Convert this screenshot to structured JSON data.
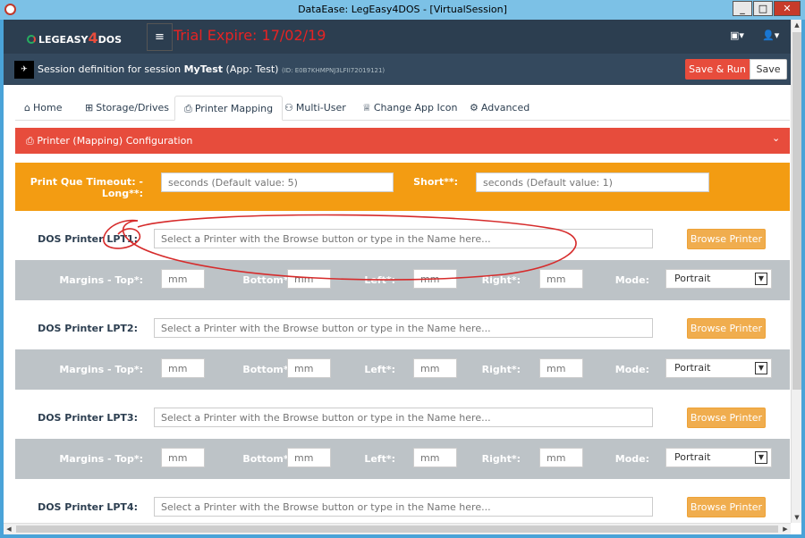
{
  "window": {
    "title": "DataEase: LegEasy4DOS - [VirtualSession]",
    "minimize": "_",
    "maximize": "□",
    "close": "✕"
  },
  "navbar": {
    "logo_prefix": "LEGEASY",
    "logo_four": "4",
    "logo_suffix": "DOS",
    "menu_icon": "≡",
    "trial_text": "Trial Expire: 17/02/19",
    "briefcase_icon": "▣▾",
    "user_icon": "👤▾"
  },
  "session": {
    "prefix": "Session definition for session",
    "name": "MyTest",
    "app": "(App: Test)",
    "id": "(ID: E0B7KHMPNJ3LFII72019121)",
    "save_run_label": "Save & Run",
    "save_label": "Save"
  },
  "tabs": [
    {
      "icon": "⌂",
      "label": "Home"
    },
    {
      "icon": "⊞",
      "label": "Storage/Drives"
    },
    {
      "icon": "⎙",
      "label": "Printer Mapping"
    },
    {
      "icon": "⚇",
      "label": "Multi-User"
    },
    {
      "icon": "♕",
      "label": "Change App Icon"
    },
    {
      "icon": "⚙",
      "label": "Advanced"
    }
  ],
  "active_tab": "Printer Mapping",
  "panel": {
    "icon": "⎙",
    "title": "Printer (Mapping) Configuration",
    "collapse_icon": "⌄"
  },
  "timeout": {
    "long_label_1": "Print Que Timeout: -",
    "long_label_2": "Long**:",
    "long_placeholder": "seconds (Default value: 5)",
    "short_label": "Short**:",
    "short_placeholder": "seconds (Default value: 1)"
  },
  "printers": [
    {
      "label": "DOS Printer LPT1:",
      "placeholder": "Select a Printer with the Browse button or type in the Name here...",
      "browse": "Browse Printer"
    },
    {
      "label": "DOS Printer LPT2:",
      "placeholder": "Select a Printer with the Browse button or type in the Name here...",
      "browse": "Browse Printer"
    },
    {
      "label": "DOS Printer LPT3:",
      "placeholder": "Select a Printer with the Browse button or type in the Name here...",
      "browse": "Browse Printer"
    },
    {
      "label": "DOS Printer LPT4:",
      "placeholder": "Select a Printer with the Browse button or type in the Name here...",
      "browse": "Browse Printer"
    }
  ],
  "margins": {
    "top_label": "Margins - Top*:",
    "bottom_label": "Bottom*:",
    "left_label": "Left*:",
    "right_label": "Right*:",
    "mode_label": "Mode:",
    "unit_placeholder": "mm",
    "mode_value": "Portrait",
    "mode_arrow": "▼"
  },
  "scroll": {
    "up": "▲",
    "down": "▼",
    "left": "◀",
    "right": "▶"
  }
}
